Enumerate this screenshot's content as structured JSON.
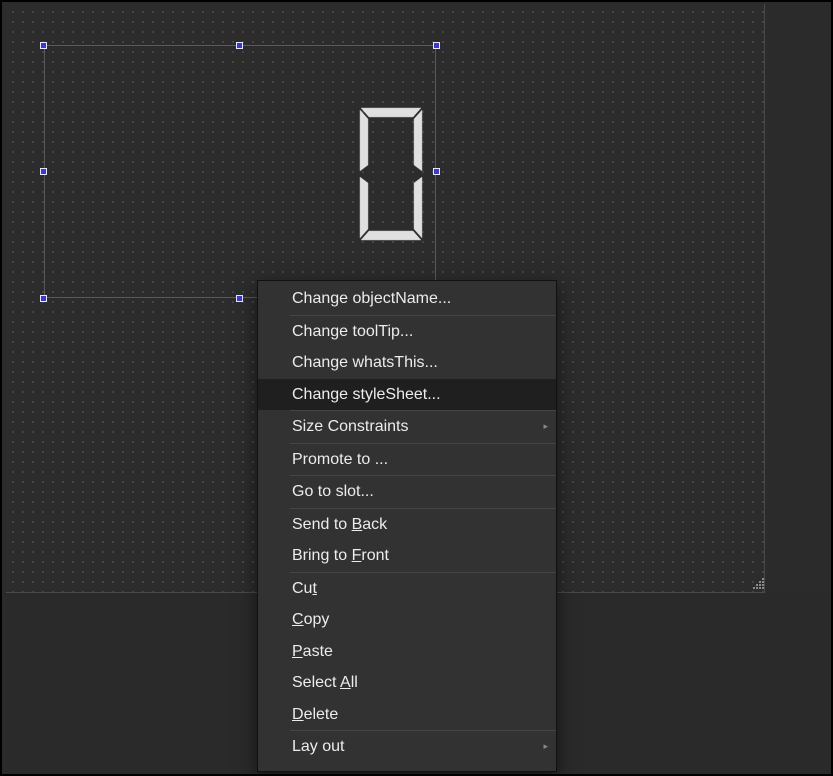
{
  "lcd": {
    "display_value": "0"
  },
  "context_menu": {
    "items": [
      {
        "label": "Change objectName...",
        "mnemonic": null,
        "submenu": false
      },
      {
        "label": "Change toolTip...",
        "mnemonic": null,
        "submenu": false
      },
      {
        "label": "Change whatsThis...",
        "mnemonic": null,
        "submenu": false
      },
      {
        "label": "Change styleSheet...",
        "mnemonic": null,
        "submenu": false,
        "highlighted": true
      },
      {
        "label": "Size Constraints",
        "mnemonic": null,
        "submenu": true
      },
      {
        "label": "Promote to ...",
        "mnemonic": null,
        "submenu": false
      },
      {
        "label": "Go to slot...",
        "mnemonic": null,
        "submenu": false
      },
      {
        "label": "Send to Back",
        "mnemonic": "B",
        "submenu": false
      },
      {
        "label": "Bring to Front",
        "mnemonic": "F",
        "submenu": false
      },
      {
        "label": "Cut",
        "mnemonic": "t",
        "submenu": false
      },
      {
        "label": "Copy",
        "mnemonic": "C",
        "submenu": false
      },
      {
        "label": "Paste",
        "mnemonic": "P",
        "submenu": false
      },
      {
        "label": "Select All",
        "mnemonic": "A",
        "submenu": false
      },
      {
        "label": "Delete",
        "mnemonic": "D",
        "submenu": false
      },
      {
        "label": "Lay out",
        "mnemonic": null,
        "submenu": true
      }
    ],
    "separators_after": [
      0,
      3,
      4,
      5,
      6,
      8,
      13
    ],
    "submenu_arrow": "▸"
  },
  "colors": {
    "canvas": "#2c2c2c",
    "menu_background": "#323232",
    "menu_highlight": "#1f1f1f",
    "selection_handle": "#3b3bc8",
    "lcd_segment": "#e0e0e0"
  }
}
